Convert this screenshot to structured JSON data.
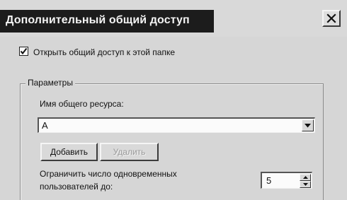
{
  "window": {
    "title": "Дополнительный общий доступ"
  },
  "share_checkbox": {
    "label": "Открыть общий доступ к этой папке",
    "checked": true
  },
  "parameters": {
    "legend": "Параметры",
    "share_name_label": "Имя общего ресурса:",
    "share_name_value": "A",
    "add_button": "Добавить",
    "remove_button": "Удалить",
    "remove_enabled": false,
    "limit_label_line1": "Ограничить число одновременных",
    "limit_label_line2": "пользователей до:",
    "limit_value": "5"
  },
  "icons": {
    "close": "close-icon",
    "check": "checkmark-icon",
    "dropdown": "chevron-down-icon",
    "spin_up": "spin-up-icon",
    "spin_down": "spin-down-icon"
  }
}
